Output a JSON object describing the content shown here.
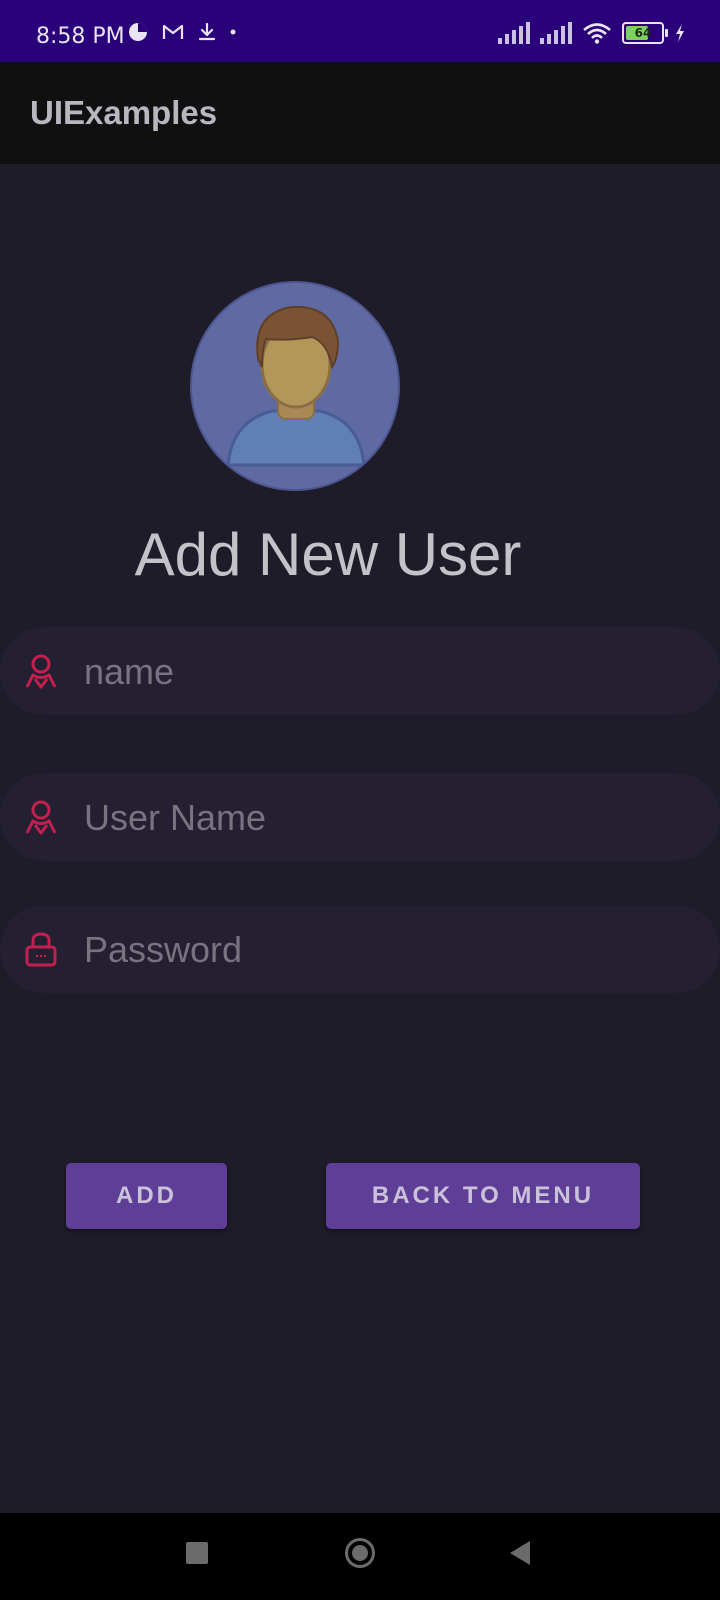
{
  "status_bar": {
    "time": "8:58 PM",
    "battery_level": "64"
  },
  "app_bar": {
    "title": "UIExamples"
  },
  "page": {
    "title": "Add New User"
  },
  "form": {
    "name_placeholder": "name",
    "username_placeholder": "User Name",
    "password_placeholder": "Password"
  },
  "buttons": {
    "add_label": "ADD",
    "back_label": "BACK TO MENU"
  },
  "colors": {
    "status_bar": "#2a007a",
    "background": "#1f1c29",
    "accent_button": "#5f3e98",
    "field_icon": "#c2204f"
  }
}
